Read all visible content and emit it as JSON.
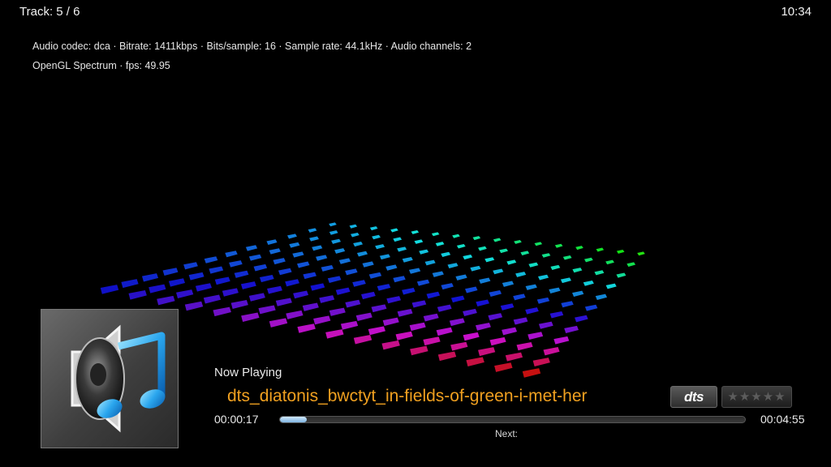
{
  "header": {
    "track_label": "Track: 5 / 6",
    "clock": "10:34"
  },
  "info": {
    "codec_line": "Audio codec: dca · Bitrate: 1411kbps · Bits/sample: 16 · Sample rate: 44.1kHz · Audio channels: 2",
    "viz_line": "OpenGL Spectrum · fps: 49.95"
  },
  "player": {
    "now_playing_label": "Now Playing",
    "title": "dts_diatonis_bwctyt_in-fields-of-green-i-met-her",
    "codec_badge": "dts",
    "rating_stars": "★★★★★",
    "rating_value": 0,
    "elapsed": "00:00:17",
    "total": "00:04:55",
    "progress_fraction": 0.058,
    "next_label": "Next:"
  },
  "icons": {
    "album_art": "speaker-music-note-icon"
  },
  "colors": {
    "title": "#f0a020",
    "progress_fill": "#8fc0e8"
  }
}
